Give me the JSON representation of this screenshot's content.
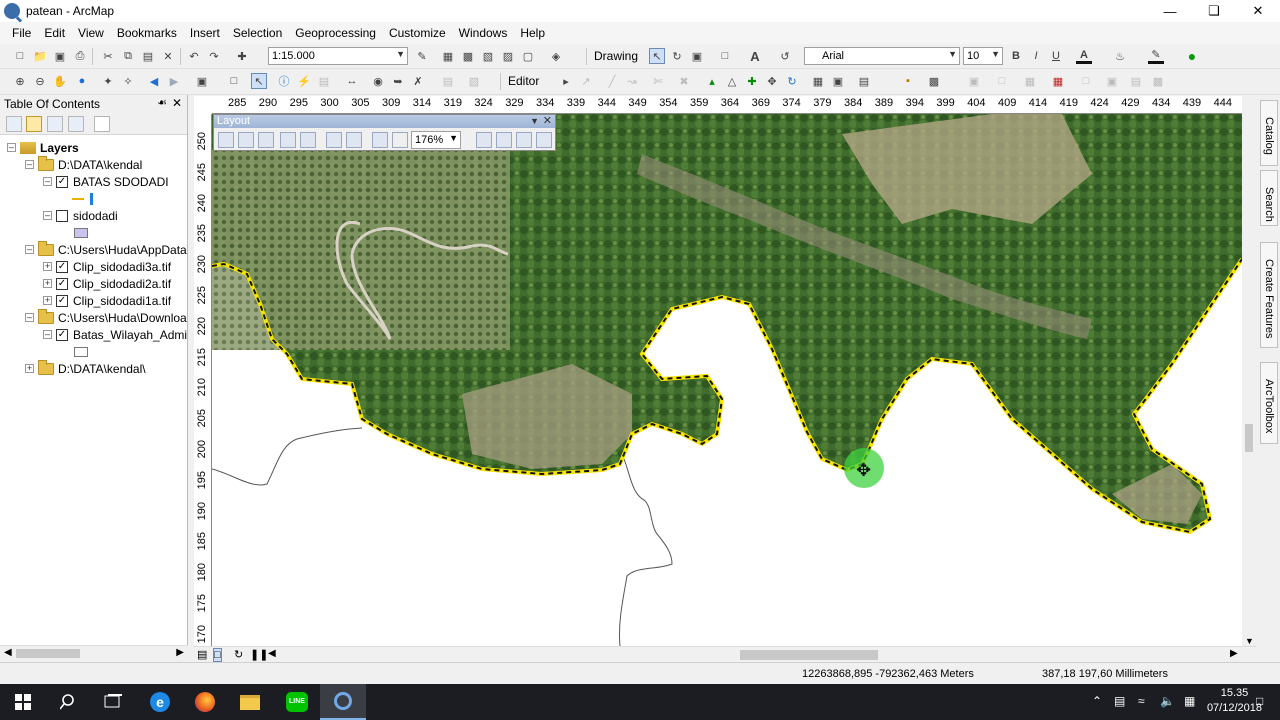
{
  "window": {
    "title": "patean - ArcMap"
  },
  "menu": [
    "File",
    "Edit",
    "View",
    "Bookmarks",
    "Insert",
    "Selection",
    "Geoprocessing",
    "Customize",
    "Windows",
    "Help"
  ],
  "toolbar": {
    "scale": "1:15.000",
    "drawing_label": "Drawing",
    "font_name": "Arial",
    "font_size": "10",
    "editor_label": "Editor",
    "bold": "B",
    "italic": "I",
    "underline": "U",
    "font_color_letter": "A"
  },
  "toc": {
    "title": "Table Of Contents",
    "root": "Layers",
    "items": [
      {
        "label": "D:\\DATA\\kendal"
      },
      {
        "label": "BATAS SDODADI"
      },
      {
        "label": "sidodadi"
      },
      {
        "label": "C:\\Users\\Huda\\AppData\\"
      },
      {
        "label": "Clip_sidodadi3a.tif"
      },
      {
        "label": "Clip_sidodadi2a.tif"
      },
      {
        "label": "Clip_sidodadi1a.tif"
      },
      {
        "label": "C:\\Users\\Huda\\Downloac"
      },
      {
        "label": "Batas_Wilayah_Admin"
      },
      {
        "label": "D:\\DATA\\kendal\\"
      }
    ]
  },
  "layout_toolbar": {
    "title": "Layout",
    "zoom": "176%"
  },
  "ruler_top": [
    "285",
    "290",
    "295",
    "300",
    "305",
    "309",
    "314",
    "319",
    "324",
    "329",
    "334",
    "339",
    "344",
    "349",
    "354",
    "359",
    "364",
    "369",
    "374",
    "379",
    "384",
    "389",
    "394",
    "399",
    "404",
    "409",
    "414",
    "419",
    "424",
    "429",
    "434",
    "439",
    "444"
  ],
  "ruler_left": [
    "250",
    "245",
    "240",
    "235",
    "230",
    "225",
    "220",
    "215",
    "210",
    "205",
    "200",
    "195",
    "190",
    "185",
    "180",
    "175",
    "170"
  ],
  "side_tabs": [
    "Catalog",
    "Search",
    "Create Features",
    "ArcToolbox"
  ],
  "status": {
    "coords": "12263868,895  -792362,463 Meters",
    "page_coords": "387,18  197,60 Millimeters"
  },
  "taskbar": {
    "time": "15.35",
    "date": "07/12/2018"
  },
  "colors": {
    "boundary": "#f5e400",
    "title_gradient": "#b9cbe4",
    "cursor_highlight": "#3fd13f"
  }
}
